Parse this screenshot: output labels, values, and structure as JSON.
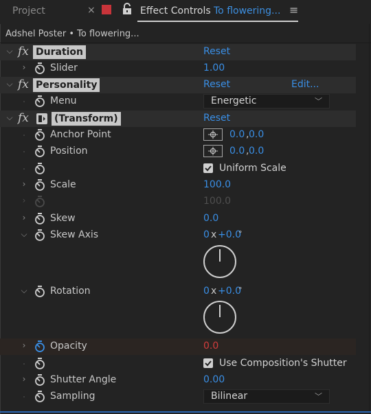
{
  "tabs": {
    "project_label": "Project",
    "close_glyph": "×",
    "active_title": "Effect Controls",
    "active_layer": "To flowering...",
    "menu_glyph": "≡",
    "label_color": "#c8343a"
  },
  "breadcrumb": "Adshel Poster • To flowering...",
  "effects": {
    "duration": {
      "name": "Duration",
      "reset": "Reset",
      "slider_label": "Slider",
      "slider_value": "1.00"
    },
    "personality": {
      "name": "Personality",
      "reset": "Reset",
      "edit": "Edit...",
      "menu_label": "Menu",
      "menu_value": "Energetic"
    },
    "transform": {
      "name": "(Transform)",
      "reset": "Reset",
      "anchor_label": "Anchor Point",
      "anchor_x": "0.0",
      "anchor_sep": ",",
      "anchor_y": "0.0",
      "position_label": "Position",
      "position_x": "0.0",
      "position_sep": ",",
      "position_y": "0.0",
      "uniform_scale_label": "Uniform Scale",
      "uniform_scale_checked": true,
      "scale_label": "Scale",
      "scale_value": "100.0",
      "scale2_value": "100.0",
      "skew_label": "Skew",
      "skew_value": "0.0",
      "skew_axis_label": "Skew Axis",
      "skew_axis_rev": "0",
      "skew_axis_x": "x",
      "skew_axis_deg": "+0.0",
      "skew_axis_unit": "°",
      "rotation_label": "Rotation",
      "rotation_rev": "0",
      "rotation_x": "x",
      "rotation_deg": "+0.0",
      "rotation_unit": "°",
      "opacity_label": "Opacity",
      "opacity_value": "0.0",
      "use_comp_shutter_label": "Use Composition's Shutter",
      "use_comp_shutter_checked": true,
      "shutter_label": "Shutter Angle",
      "shutter_value": "0.00",
      "sampling_label": "Sampling",
      "sampling_value": "Bilinear"
    }
  },
  "colors": {
    "background": "#232323",
    "accent_blue": "#3a8fe6",
    "keyframed_red": "#d33d3d",
    "header_row": "#2d2d2d"
  }
}
